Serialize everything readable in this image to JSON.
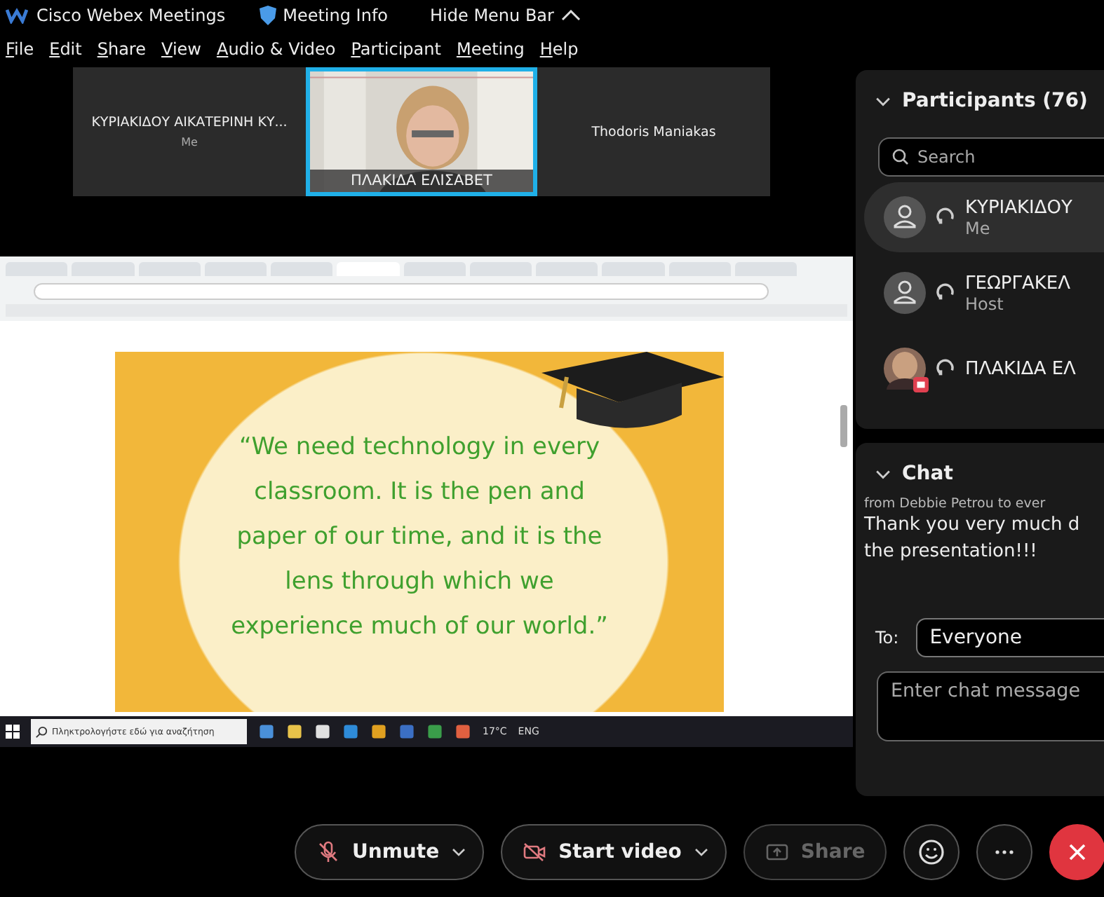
{
  "app_bar": {
    "title": "Cisco Webex Meetings",
    "meeting_info": "Meeting Info",
    "hide_menu": "Hide Menu Bar"
  },
  "menu": [
    "File",
    "Edit",
    "Share",
    "View",
    "Audio & Video",
    "Participant",
    "Meeting",
    "Help"
  ],
  "thumbnails": [
    {
      "kind": "name",
      "name": "ΚΥΡΙΑΚΙΔΟΥ ΑΙΚΑΤΕΡΙΝΗ ΚΥ...",
      "subtitle": "Me",
      "selected": false
    },
    {
      "kind": "video",
      "name": "ΠΛΑΚΙΔΑ ΕΛΙΣΑΒΕΤ",
      "selected": true
    },
    {
      "kind": "name",
      "name": "Thodoris Maniakas",
      "selected": false
    }
  ],
  "shared_screen": {
    "browser_tabs": [
      {
        "selected": false
      },
      {
        "selected": false
      },
      {
        "selected": false
      },
      {
        "selected": false
      },
      {
        "selected": false
      },
      {
        "selected": true
      },
      {
        "selected": false
      },
      {
        "selected": false
      },
      {
        "selected": false
      },
      {
        "selected": false
      },
      {
        "selected": false
      },
      {
        "selected": false
      }
    ],
    "quote": "“We need technology in every classroom. It is the pen and paper of our time, and it is the lens through which we experience much of our world.”",
    "taskbar": {
      "search_placeholder": "Πληκτρολογήστε εδώ για αναζήτηση",
      "temperature": "17°C",
      "language": "ENG"
    }
  },
  "participants": {
    "title": "Participants (76)",
    "expanded": true,
    "search_placeholder": "Search",
    "items": [
      {
        "kind": "avatar",
        "name": "ΚΥΡΙΑΚΙΔΟΥ",
        "role": "Me",
        "selected": true
      },
      {
        "kind": "avatar",
        "name": "ΓΕΩΡΓΑΚΕΛ",
        "role": "Host",
        "selected": false
      },
      {
        "name": "ΠΛΑΚΙΔΑ ΕΛ",
        "selected": false
      }
    ]
  },
  "chat": {
    "title": "Chat",
    "expanded": true,
    "header": "from Debbie Petrou to ever",
    "lines": [
      "Thank you very much d",
      "the presentation!!!"
    ],
    "to_label": "To:",
    "to_value": "Everyone",
    "placeholder": "Enter chat message"
  },
  "toolbar": [
    {
      "kind": "mute",
      "label": "Unmute",
      "dropdown": true,
      "disabled": false
    },
    {
      "kind": "video",
      "label": "Start video",
      "dropdown": true,
      "disabled": false
    },
    {
      "kind": "share",
      "label": "Share",
      "dropdown": false,
      "disabled": true
    },
    {
      "kind": "reactions"
    },
    {
      "kind": "more"
    },
    {
      "kind": "leave"
    }
  ]
}
